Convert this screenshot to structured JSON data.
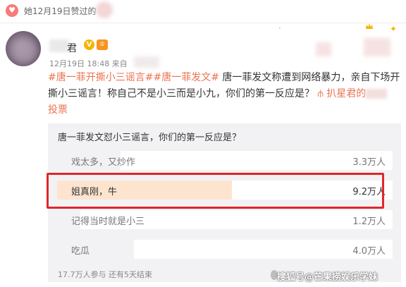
{
  "liked_bar": {
    "text": "她12月19日赞过的"
  },
  "post": {
    "author_name": "君",
    "meta": "12月19日 18:48 来自",
    "tags": [
      "#唐一菲开撕小三谣言#",
      "#唐一菲发文#"
    ],
    "body": "唐一菲发文称遭到网络暴力，亲自下场开撕小三谣言！称自己不是小三而是小九，你们的第一反应是？",
    "source_label": "扒星君的",
    "vote_link": "投票"
  },
  "vote": {
    "question": "唐一菲发文怼小三谣言，你们的第一反应是？",
    "options": [
      {
        "label": "戏太多，又炒作",
        "count": "3.3万人",
        "share": 0.19
      },
      {
        "label": "姐真刚，牛",
        "count": "9.2万人",
        "share": 0.52
      },
      {
        "label": "记得当时就是小三",
        "count": "1.2万人",
        "share": 0.07
      },
      {
        "label": "吃瓜",
        "count": "4.0万人",
        "share": 0.23
      }
    ],
    "footer": "17.7万人参与  还有5天结束"
  },
  "watermark": "搜狐号@芒果捞娱乐学妹",
  "colors": {
    "accent": "#eb7350",
    "highlight_box": "#e0262a",
    "top_fill": "#fde4cf",
    "panel": "#f2f2f5"
  }
}
